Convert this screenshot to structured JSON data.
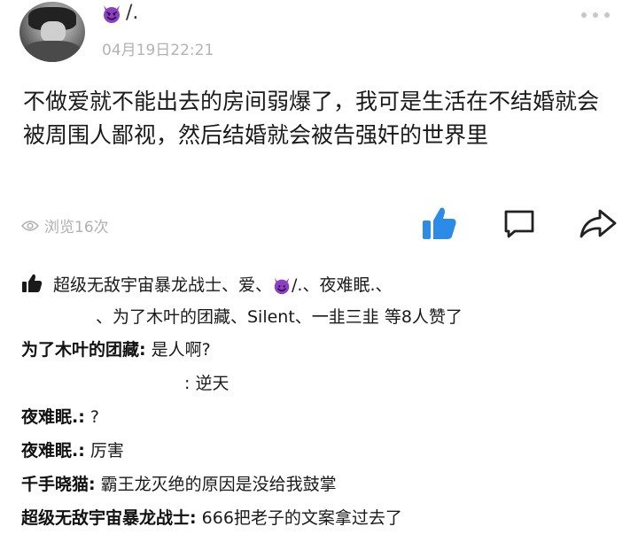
{
  "user": {
    "name_suffix": "/.",
    "emoji_icon": "smiling-devil-icon",
    "time": "04月19日22:21"
  },
  "post": {
    "text": "不做爱就不能出去的房间弱爆了，我可是生活在不结婚就会被周围人鄙视，然后结婚就会被告强奸的世界里"
  },
  "stats": {
    "views": "浏览16次"
  },
  "likes": {
    "line1_before_emoji": "超级无敌宇宙暴龙战士、爱、",
    "line1_after_emoji": "/.、夜难眠.、",
    "line2": "、为了木叶的团藏、Silent、一韭三韭 等8人赞了"
  },
  "comments": [
    {
      "author": "为了木叶的团藏:",
      "text": " 是人啊?"
    },
    {
      "author": "",
      "text": ": 逆天"
    },
    {
      "author": "夜难眠.:",
      "text": " ?"
    },
    {
      "author": "夜难眠.:",
      "text": " 厉害"
    },
    {
      "author": "千手晓猫:",
      "text": " 霸王龙灭绝的原因是没给我鼓掌"
    },
    {
      "author": "超级无敌宇宙暴龙战士:",
      "text": " 666把老子的文案拿过去了"
    }
  ],
  "colors": {
    "devil_purple": "#8b3fc4",
    "like_blue": "#2b8be6",
    "muted_gray": "#b3b3b3"
  }
}
